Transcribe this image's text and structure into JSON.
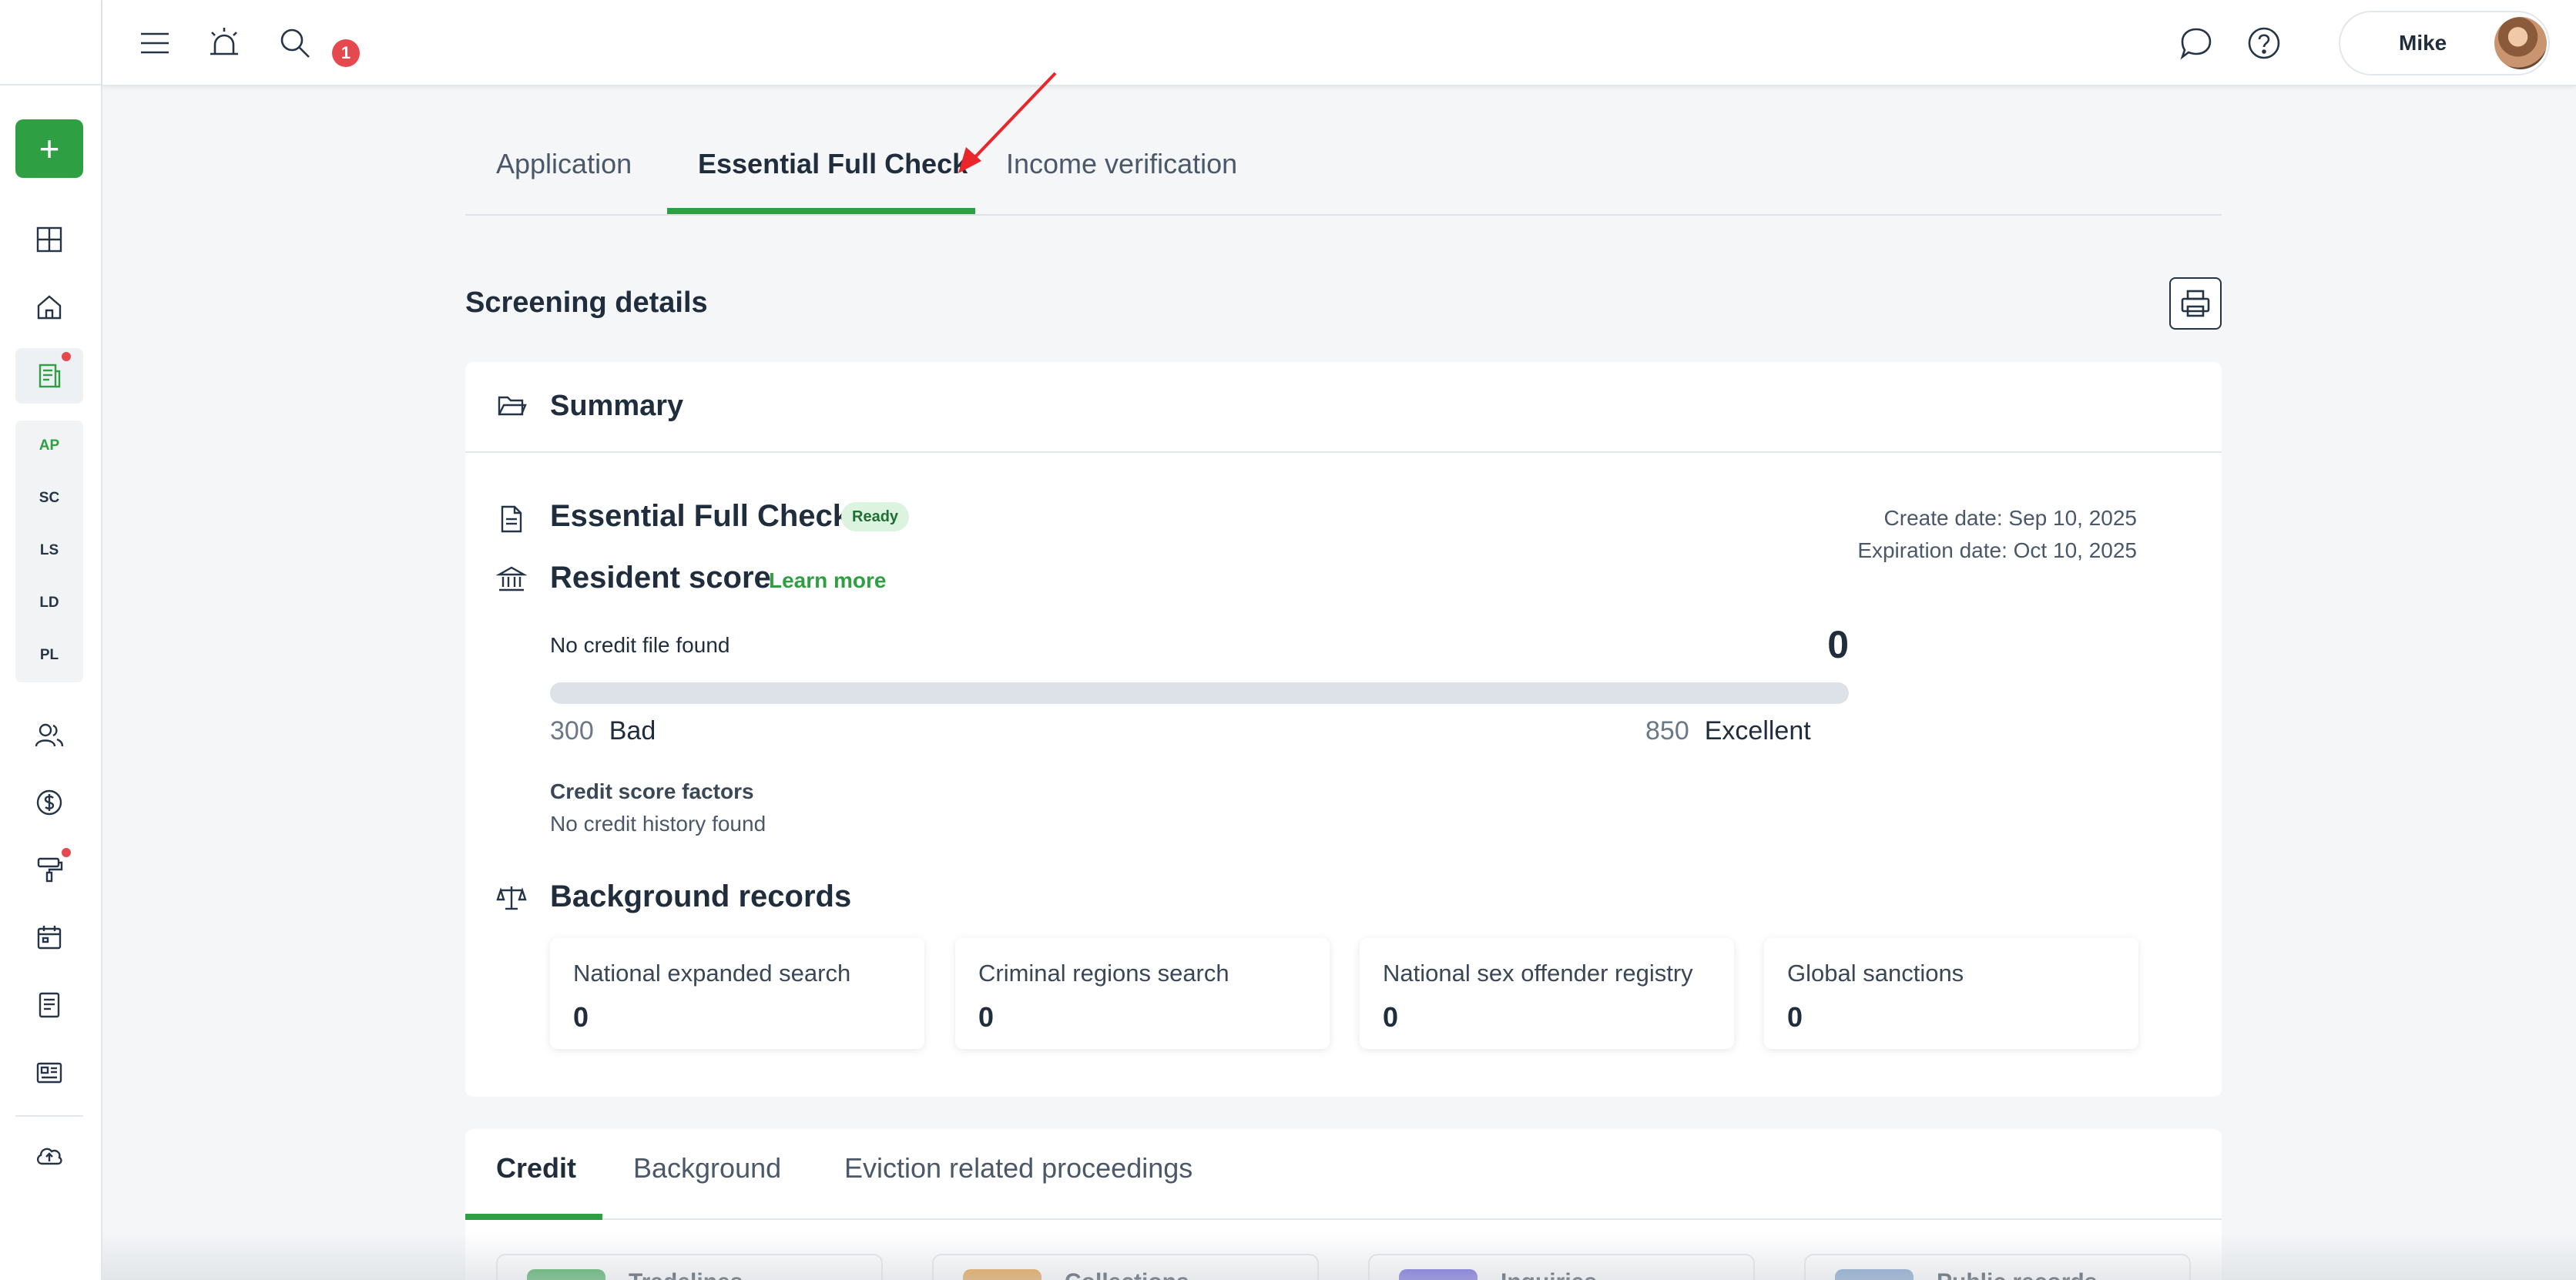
{
  "header": {
    "notification_count": "1",
    "user_name": "Mike"
  },
  "sidebar": {
    "add_label": "+",
    "sub_items": [
      "AP",
      "SC",
      "LS",
      "LD",
      "PL"
    ]
  },
  "main_tabs": [
    "Application",
    "Essential Full Check",
    "Income verification"
  ],
  "screening": {
    "title": "Screening details"
  },
  "summary": {
    "title": "Summary",
    "check_title": "Essential Full Check",
    "status": "Ready",
    "create_date": "Create date: Sep 10, 2025",
    "expiration_date": "Expiration date: Oct 10, 2025",
    "score_title": "Resident score",
    "learn_more": "Learn more",
    "credit_status": "No credit file found",
    "score": "0",
    "score_fill": 0,
    "min_value": "300",
    "min_label": "Bad",
    "max_value": "850",
    "max_label": "Excellent",
    "factors_label": "Credit score factors",
    "factors_value": "No credit history found",
    "background_title": "Background records",
    "records": [
      {
        "label": "National expanded search",
        "value": "0"
      },
      {
        "label": "Criminal regions search",
        "value": "0"
      },
      {
        "label": "National sex offender registry",
        "value": "0"
      },
      {
        "label": "Global sanctions",
        "value": "0"
      }
    ]
  },
  "bottom_tabs": [
    "Credit",
    "Background",
    "Eviction related proceedings"
  ],
  "bottom_cards": [
    {
      "label": "Tradelines",
      "color": "#2ea043"
    },
    {
      "label": "Collections",
      "color": "#e0902a"
    },
    {
      "label": "Inquiries",
      "color": "#5b4fd6"
    },
    {
      "label": "Public records",
      "color": "#6f95c4"
    }
  ],
  "colors": {
    "accent": "#2ea043",
    "alert": "#e5484d",
    "annotation_arrow": "#e8262b"
  }
}
